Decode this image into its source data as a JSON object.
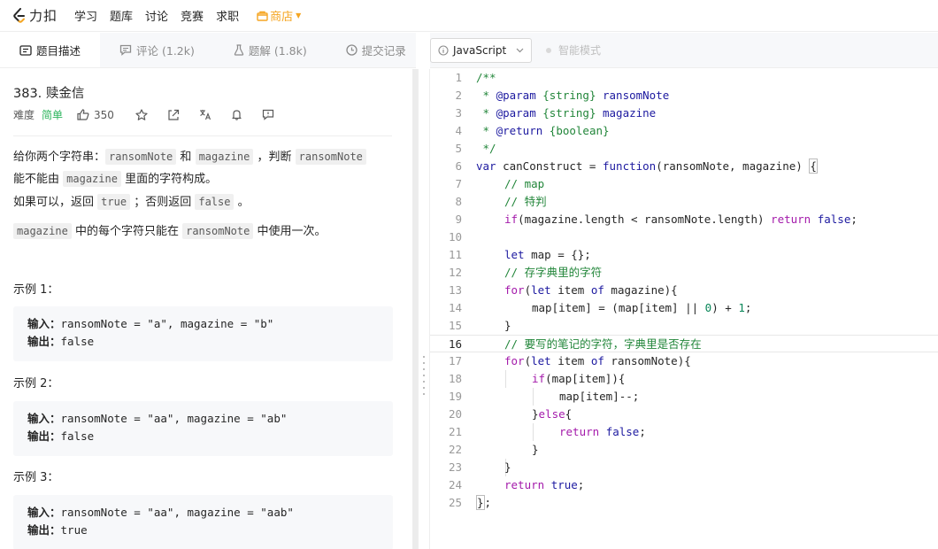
{
  "nav": {
    "logo_text": "力扣",
    "items": [
      "学习",
      "题库",
      "讨论",
      "竞赛",
      "求职"
    ],
    "shop_label": "商店"
  },
  "left_tabs": [
    {
      "label": "题目描述",
      "icon": "description-icon"
    },
    {
      "label": "评论 (1.2k)",
      "icon": "comment-icon"
    },
    {
      "label": "题解 (1.8k)",
      "icon": "flask-icon"
    },
    {
      "label": "提交记录",
      "icon": "clock-icon"
    }
  ],
  "problem": {
    "title": "383. 赎金信",
    "difficulty_label": "难度",
    "difficulty": "简单",
    "likes": "350",
    "desc1_a": "给你两个字符串：",
    "desc1_code1": "ransomNote",
    "desc1_b": "和",
    "desc1_code2": "magazine",
    "desc1_c": "，判断",
    "desc1_code3": "ransomNote",
    "desc1_d": "能不能由",
    "desc1_code4": "magazine",
    "desc1_e": "里面的字符构成。",
    "desc2_a": "如果可以，返回",
    "desc2_code1": "true",
    "desc2_b": "；否则返回",
    "desc2_code2": "false",
    "desc2_c": "。",
    "desc3_code1": "magazine",
    "desc3_a": "中的每个字符只能在",
    "desc3_code2": "ransomNote",
    "desc3_b": "中使用一次。",
    "input_label": "输入：",
    "output_label": "输出：",
    "examples": [
      {
        "heading": "示例 1：",
        "input": "ransomNote = \"a\", magazine = \"b\"",
        "output": "false"
      },
      {
        "heading": "示例 2：",
        "input": "ransomNote = \"aa\", magazine = \"ab\"",
        "output": "false"
      },
      {
        "heading": "示例 3：",
        "input": "ransomNote = \"aa\", magazine = \"aab\"",
        "output": "true"
      }
    ]
  },
  "editor": {
    "language": "JavaScript",
    "smart_mode": "智能模式",
    "current_line": 16,
    "line_numbers": [
      "1",
      "2",
      "3",
      "4",
      "5",
      "6",
      "7",
      "8",
      "9",
      "10",
      "11",
      "12",
      "13",
      "14",
      "15",
      "16",
      "17",
      "18",
      "19",
      "20",
      "21",
      "22",
      "23",
      "24",
      "25"
    ],
    "tokens": {
      "t1": "/**",
      "t2a": " * ",
      "t2b": "@param",
      "t2c": " {string} ",
      "t2d": "ransomNote",
      "t3a": " * ",
      "t3b": "@param",
      "t3c": " {string} ",
      "t3d": "magazine",
      "t4a": " * ",
      "t4b": "@return",
      "t4c": " {boolean}",
      "t5": " */",
      "t6a": "var",
      "t6b": " canConstruct = ",
      "t6c": "function",
      "t6d": "(ransomNote, magazine) ",
      "t6e": "{",
      "t7": "// map",
      "t8": "// 特判",
      "t9a": "if",
      "t9b": "(magazine.length < ransomNote.length) ",
      "t9c": "return",
      "t9d": " ",
      "t9e": "false",
      "t9f": ";",
      "t11a": "let",
      "t11b": " map = {};",
      "t12": "// 存字典里的字符",
      "t13a": "for",
      "t13b": "(",
      "t13c": "let",
      "t13d": " item ",
      "t13e": "of",
      "t13f": " magazine){",
      "t14a": "map[item] = (map[item] || ",
      "t14b": "0",
      "t14c": ") + ",
      "t14d": "1",
      "t14e": ";",
      "t15": "}",
      "t16": "// 要写的笔记的字符，字典里是否存在",
      "t17a": "for",
      "t17b": "(",
      "t17c": "let",
      "t17d": " item ",
      "t17e": "of",
      "t17f": " ransomNote){",
      "t18a": "if",
      "t18b": "(map[item]){",
      "t19": "map[item]--;",
      "t20a": "}",
      "t20b": "else",
      "t20c": "{",
      "t21a": "return",
      "t21b": " ",
      "t21c": "false",
      "t21d": ";",
      "t22": "}",
      "t23": "}",
      "t24a": "return",
      "t24b": " ",
      "t24c": "true",
      "t24d": ";",
      "t25a": "}",
      "t25b": ";"
    }
  }
}
